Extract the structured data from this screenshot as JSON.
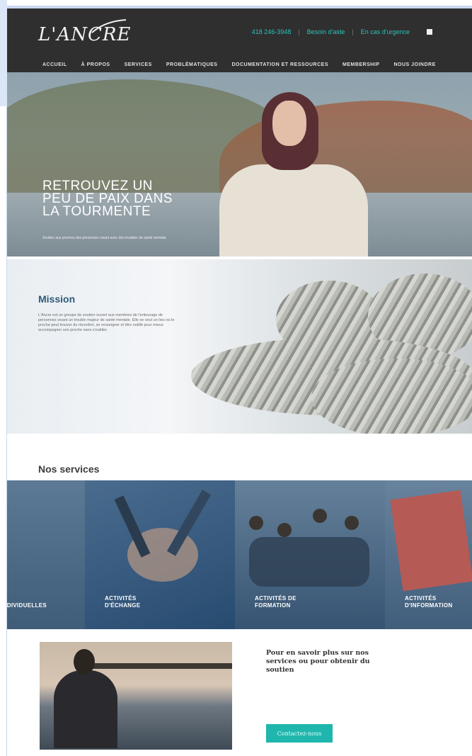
{
  "header": {
    "logo_text": "L'ANCRE",
    "phone": "418 246-3948",
    "help_link": "Besoin d'aide",
    "urgent_link": "En cas d'urgence",
    "nav": [
      "ACCUEIL",
      "À PROPOS",
      "SERVICES",
      "PROBLÉMATIQUES",
      "DOCUMENTATION ET RESSOURCES",
      "MEMBERSHIP",
      "NOUS JOINDRE"
    ]
  },
  "hero": {
    "title": "RETROUVEZ UN PEU DE PAIX DANS LA TOURMENTE",
    "subtitle": "Soutien aux proches des personnes vivant avec des troubles de santé mentale"
  },
  "mission": {
    "title": "Mission",
    "text": "L'Ancre est un groupe de soutien ouvert aux membres de l'entourage de personnes vivant un trouble majeur de santé mentale. Elle se veut un lieu où le proche peut trouver du réconfort, se renseigner et être outillé pour mieux accompagner son proche sans s'oublier."
  },
  "services": {
    "title": "Nos services",
    "items": [
      {
        "label": "ACTIVITÉS INDIVIDUELLES"
      },
      {
        "label": "ACTIVITÉS D'ÉCHANGE"
      },
      {
        "label": "ACTIVITÉS DE FORMATION"
      },
      {
        "label": "ACTIVITÉS D'INFORMATION"
      }
    ]
  },
  "contact": {
    "text": "Pour en savoir plus sur nos services ou pour obtenir du soutien",
    "button_label": "Contactez-nous"
  },
  "colors": {
    "header_bg": "#2f2f2f",
    "accent": "#1fb6ad",
    "mission_title": "#2d5a78"
  }
}
